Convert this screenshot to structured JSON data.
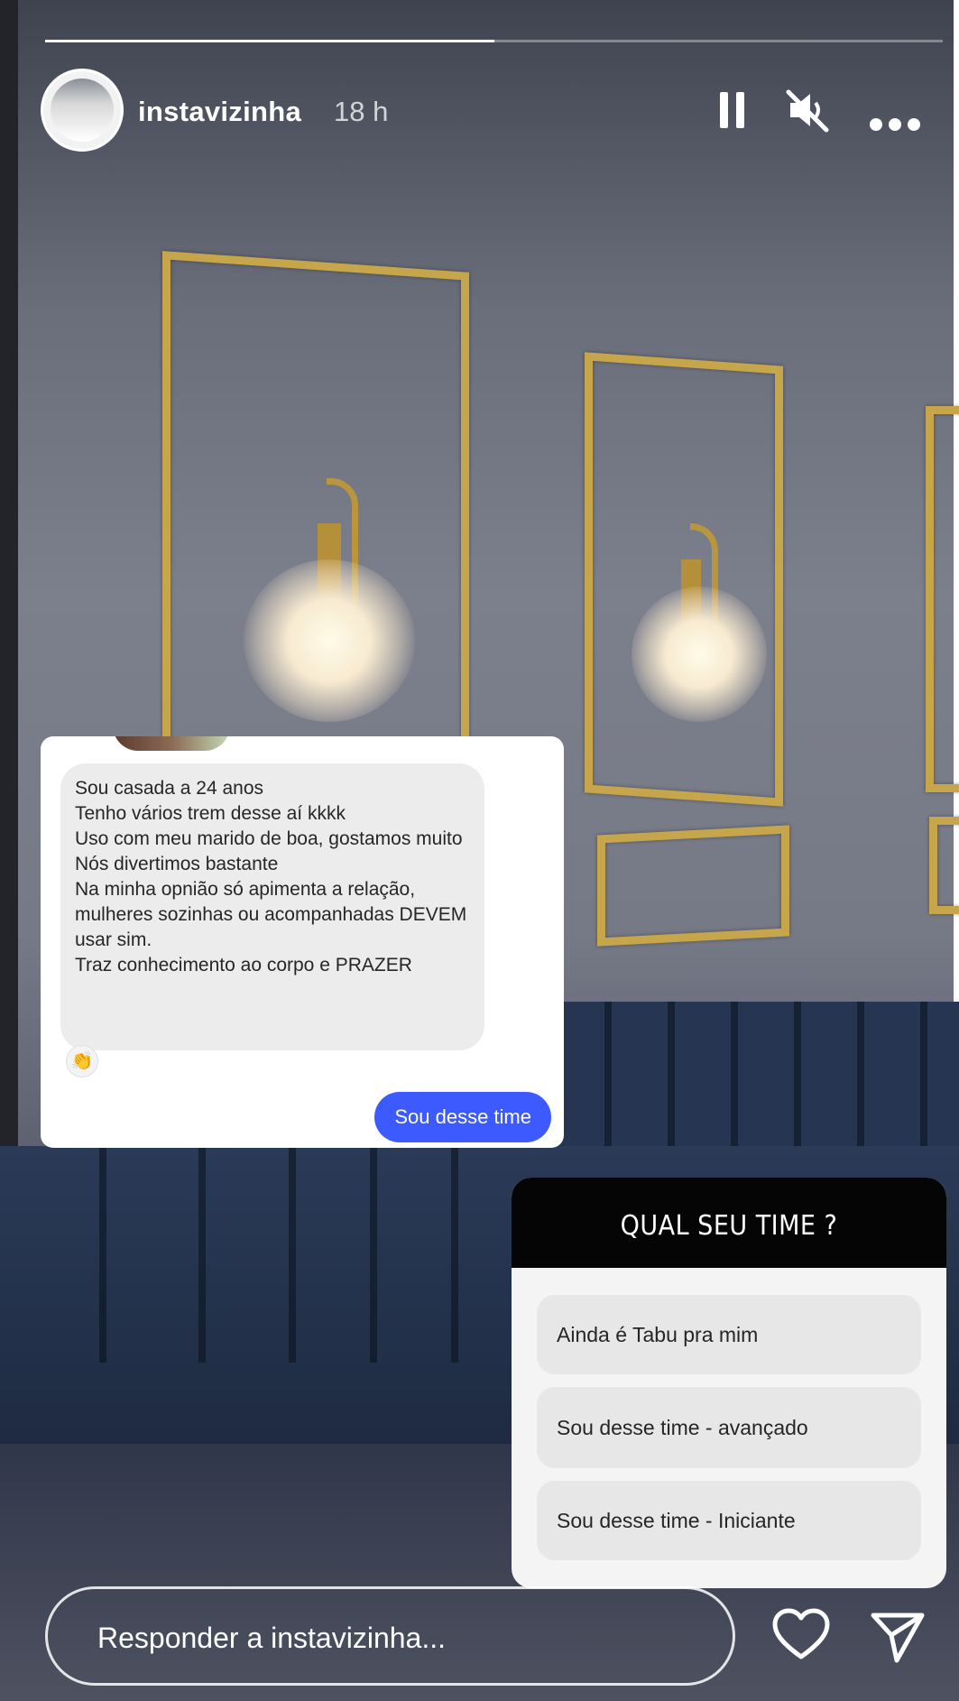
{
  "story": {
    "progress": [
      {
        "segment": 1,
        "fraction_complete": 1.0
      },
      {
        "segment": 2,
        "fraction_complete": 0.0
      }
    ],
    "username": "instavizinha",
    "time_ago": "18 h",
    "icons": {
      "pause": "pause-icon",
      "mute": "muted-speaker-icon",
      "more": "more-options-icon",
      "like": "heart-icon",
      "share": "send-icon"
    }
  },
  "dm_screenshot": {
    "message_lines": [
      "Sou casada a 24 anos",
      "Tenho vários trem desse aí kkkk",
      "Uso com meu marido de boa, gostamos muito",
      "Nós divertimos bastante",
      "Na minha opnião só apimenta a relação, mulheres sozinhas ou acompanhadas DEVEM usar sim.",
      "Traz conhecimento ao corpo e PRAZER"
    ],
    "reaction": "👏",
    "sent_reply": "Sou desse time"
  },
  "quiz": {
    "question": "QUAL SEU TIME ?",
    "options": [
      "Ainda é Tabu pra mim",
      "Sou desse time - avançado",
      "Sou desse time - Iniciante"
    ]
  },
  "reply": {
    "placeholder": "Responder a instavizinha..."
  }
}
